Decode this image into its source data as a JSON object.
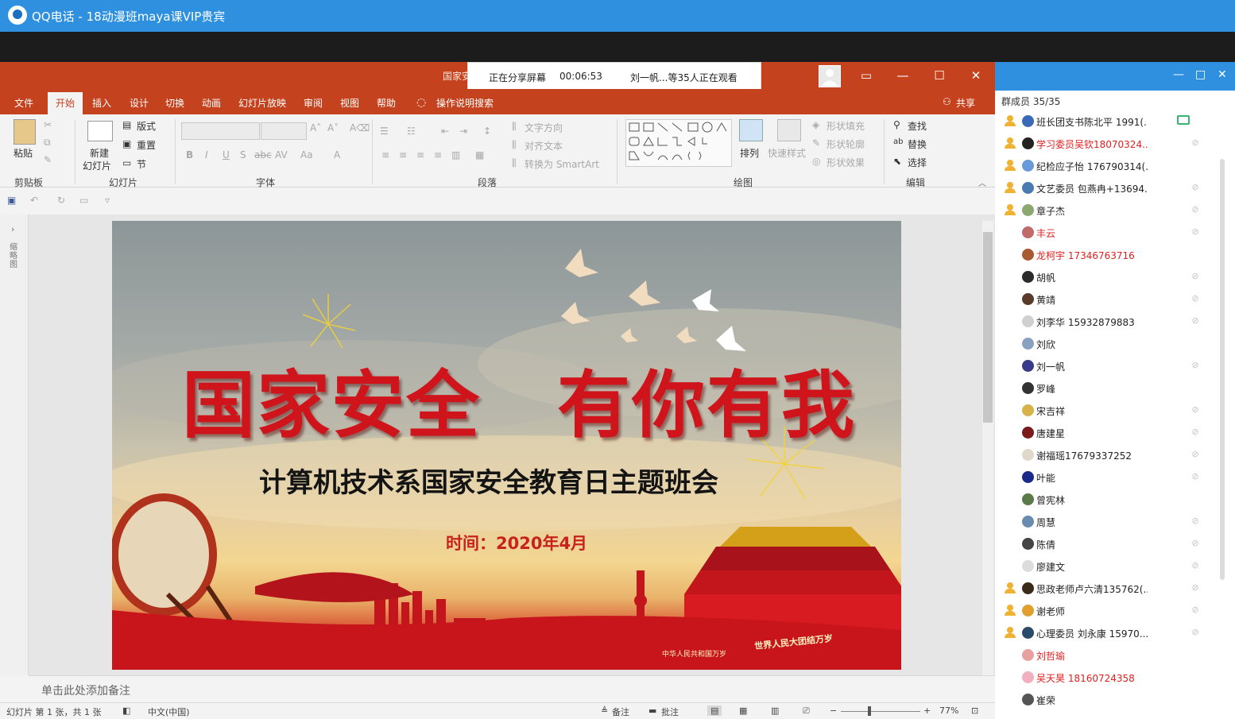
{
  "qq": {
    "app": "QQ电话",
    "separator": "-",
    "group": "18动漫班maya课VIP贵宾"
  },
  "share": {
    "status": "正在分享屏幕",
    "timer": "00:06:53",
    "viewers": "刘一帆...等35人正在观看"
  },
  "ppt": {
    "doc_title": "国家安",
    "tabs": [
      "文件",
      "开始",
      "插入",
      "设计",
      "切换",
      "动画",
      "幻灯片放映",
      "审阅",
      "视图",
      "帮助"
    ],
    "tell_me": "操作说明搜索",
    "share_btn": "共享",
    "ribbon": {
      "paste": "粘贴",
      "clipboard_group": "剪贴板",
      "new_slide_1": "新建",
      "new_slide_2": "幻灯片",
      "layout": "版式",
      "reset": "重置",
      "section": "节",
      "slides_group": "幻灯片",
      "font_group": "字体",
      "text_dir": "文字方向",
      "align_text": "对齐文本",
      "smartart": "转换为 SmartArt",
      "paragraph_group": "段落",
      "arrange": "排列",
      "quick_styles": "快速样式",
      "shape_fill": "形状填充",
      "shape_outline": "形状轮廓",
      "shape_effect": "形状效果",
      "drawing_group": "绘图",
      "find": "查找",
      "replace": "替换",
      "select": "选择",
      "editing_group": "编辑"
    },
    "thumb_label": "缩略图",
    "slide": {
      "title_left": "国家安全",
      "title_right": "有你有我",
      "subtitle": "计算机技术系国家安全教育日主题班会",
      "time": "时间：2020年4月",
      "banner1": "世界人民大团结万岁",
      "banner2": "中华人民共和国万岁"
    },
    "notes_placeholder": "单击此处添加备注",
    "status": {
      "slide_info": "幻灯片 第 1 张，共 1 张",
      "language": "中文(中国)",
      "notes": "备注",
      "comments": "批注",
      "zoom": "77%"
    }
  },
  "panel": {
    "title": "群成员",
    "count": "35/35",
    "members": [
      {
        "name": "班长团支书陈北平 1991(...",
        "crown": true,
        "red": false,
        "icon": "screen"
      },
      {
        "name": "学习委员吴钦18070324...",
        "crown": true,
        "red": true,
        "icon": "mute"
      },
      {
        "name": "纪检应子怡 176790314(...",
        "crown": true,
        "red": false,
        "icon": "none"
      },
      {
        "name": "文艺委员 包燕冉+13694...",
        "crown": true,
        "red": false,
        "icon": "mute"
      },
      {
        "name": "章子杰",
        "crown": true,
        "red": false,
        "icon": "mute"
      },
      {
        "name": "丰云",
        "crown": false,
        "red": true,
        "icon": "mute"
      },
      {
        "name": "龙柯宇 17346763716",
        "crown": false,
        "red": true,
        "icon": "none"
      },
      {
        "name": "胡帆",
        "crown": false,
        "red": false,
        "icon": "mute"
      },
      {
        "name": "黄靖",
        "crown": false,
        "red": false,
        "icon": "mute"
      },
      {
        "name": "刘李华 15932879883",
        "crown": false,
        "red": false,
        "icon": "mute"
      },
      {
        "name": "刘欣",
        "crown": false,
        "red": false,
        "icon": "none"
      },
      {
        "name": "刘一帆",
        "crown": false,
        "red": false,
        "icon": "mute"
      },
      {
        "name": "罗峰",
        "crown": false,
        "red": false,
        "icon": "none"
      },
      {
        "name": "宋吉祥",
        "crown": false,
        "red": false,
        "icon": "mute"
      },
      {
        "name": "唐建星",
        "crown": false,
        "red": false,
        "icon": "mute"
      },
      {
        "name": "谢福瑶17679337252",
        "crown": false,
        "red": false,
        "icon": "mute"
      },
      {
        "name": "叶能",
        "crown": false,
        "red": false,
        "icon": "mute"
      },
      {
        "name": "曾宪林",
        "crown": false,
        "red": false,
        "icon": "none"
      },
      {
        "name": "周慧",
        "crown": false,
        "red": false,
        "icon": "mute"
      },
      {
        "name": "陈倩",
        "crown": false,
        "red": false,
        "icon": "mute"
      },
      {
        "name": "廖建文",
        "crown": false,
        "red": false,
        "icon": "mute"
      },
      {
        "name": "思政老师卢六清135762(...",
        "crown": true,
        "red": false,
        "icon": "mute"
      },
      {
        "name": "谢老师",
        "crown": true,
        "red": false,
        "icon": "mute"
      },
      {
        "name": "心理委员  刘永康 15970...",
        "crown": true,
        "red": false,
        "icon": "mute"
      },
      {
        "name": "刘哲瑜",
        "crown": false,
        "red": true,
        "icon": "none"
      },
      {
        "name": "吴天昊 18160724358",
        "crown": false,
        "red": true,
        "icon": "none"
      },
      {
        "name": "崔荣",
        "crown": false,
        "red": false,
        "icon": "none"
      }
    ]
  },
  "colors": {
    "qq_blue": "#2f90e0",
    "ppt_orange": "#c4431e",
    "title_red": "#d0141b",
    "red_name": "#e02020"
  }
}
